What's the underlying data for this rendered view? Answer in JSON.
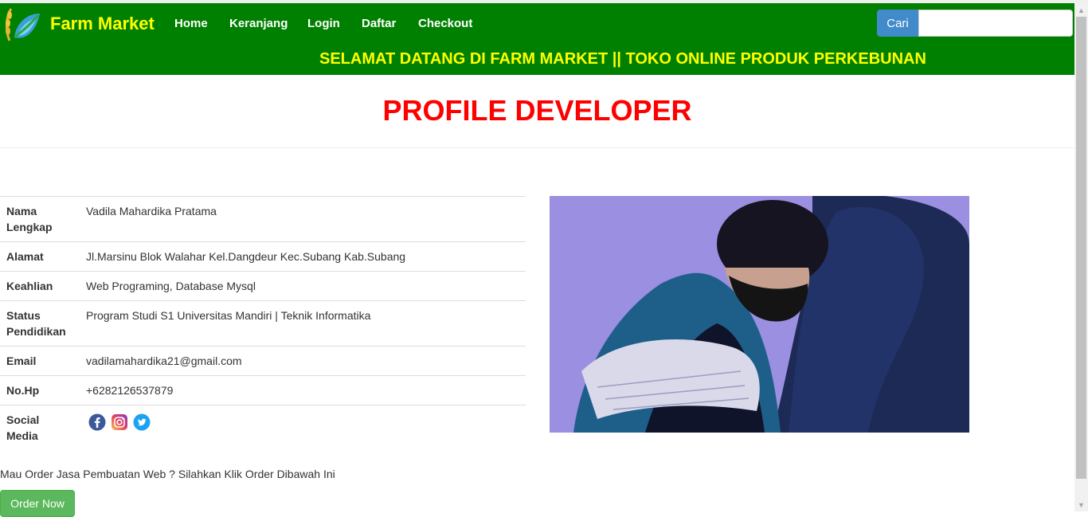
{
  "brand": {
    "name": "Farm Market"
  },
  "nav": {
    "home": "Home",
    "cart": "Keranjang",
    "login": "Login",
    "register": "Daftar",
    "checkout": "Checkout"
  },
  "search": {
    "button": "Cari",
    "value": "",
    "placeholder": ""
  },
  "marquee": "SELAMAT DATANG DI FARM MARKET || TOKO ONLINE PRODUK PERKEBUNAN",
  "page_title": "PROFILE DEVELOPER",
  "profile": {
    "name_label": "Nama Lengkap",
    "name": "Vadila Mahardika Pratama",
    "address_label": "Alamat",
    "address": "Jl.Marsinu Blok Walahar Kel.Dangdeur Kec.Subang Kab.Subang",
    "skills_label": "Keahlian",
    "skills": "Web Programing, Database Mysql",
    "education_label": "Status Pendidikan",
    "education": "Program Studi S1 Universitas Mandiri | Teknik Informatika",
    "email_label": "Email",
    "email": "vadilamahardika21@gmail.com",
    "phone_label": "No.Hp",
    "phone": "+6282126537879",
    "social_label": "Social Media",
    "social_icons": [
      "facebook-icon",
      "instagram-icon",
      "twitter-icon"
    ]
  },
  "order": {
    "text": "Mau Order Jasa Pembuatan Web ? Silahkan Klik Order Dibawah Ini",
    "button": "Order Now"
  },
  "colors": {
    "navbar": "#008000",
    "brand_text": "#ffff00",
    "title": "#ff0000",
    "search_button": "#428bca",
    "order_button": "#5cb85c"
  }
}
